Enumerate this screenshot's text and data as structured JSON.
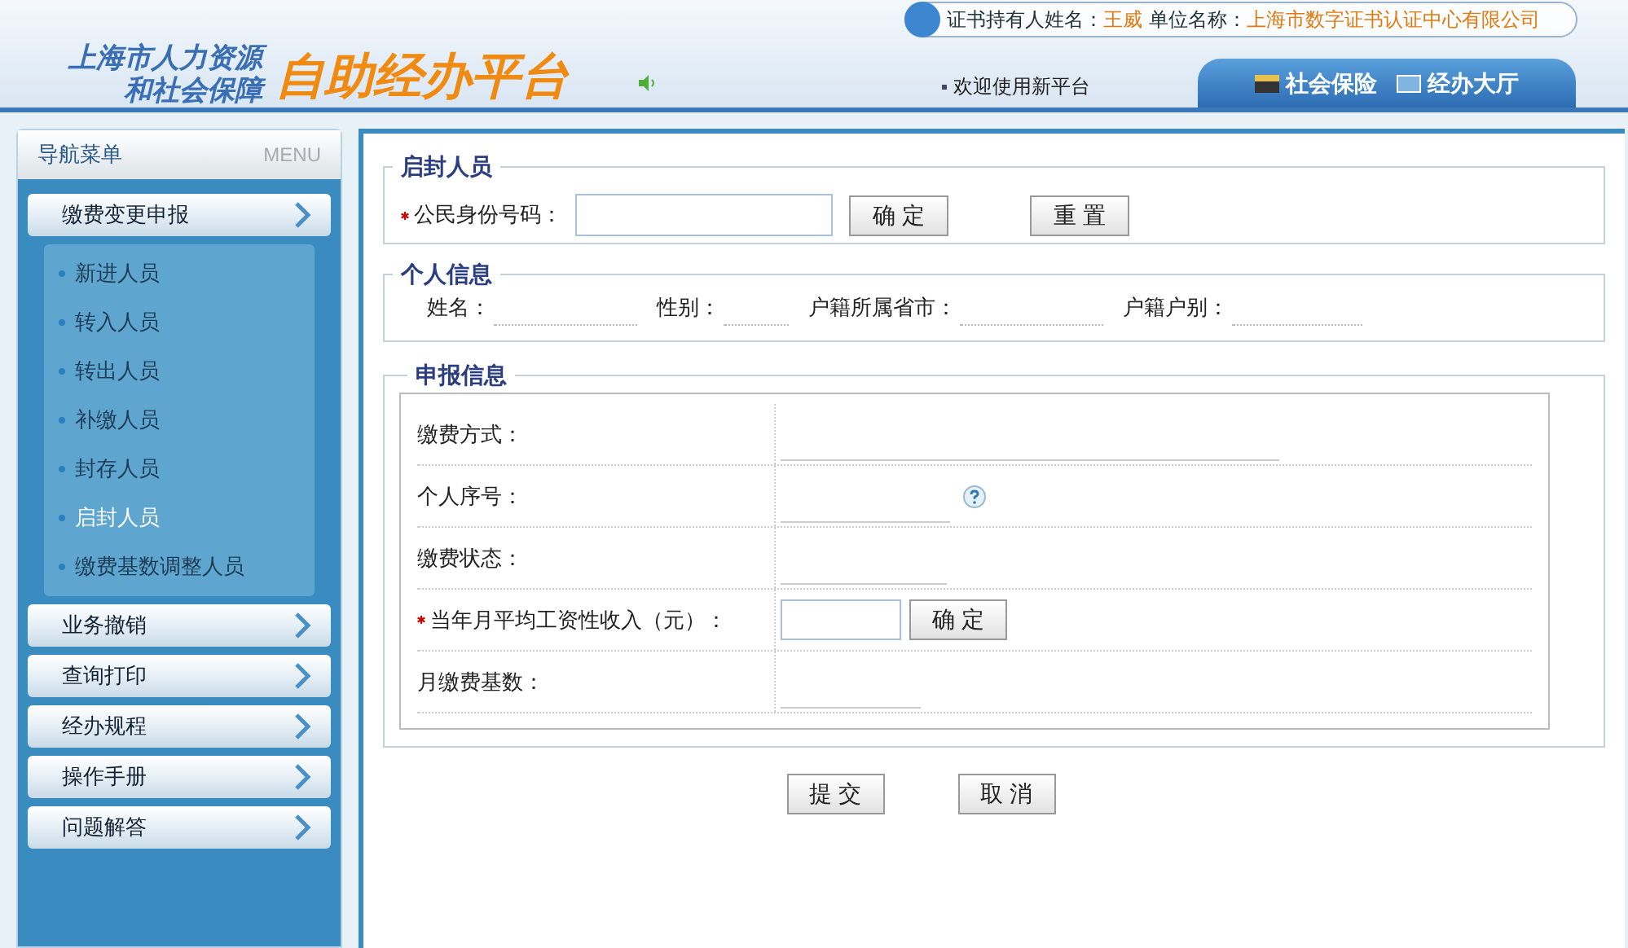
{
  "header": {
    "logo_line1": "上海市人力资源",
    "logo_line2": "和社会保障",
    "logo_main": "自助经办平台",
    "user_label": "证书持有人姓名：",
    "user_name": "王威",
    "unit_label": "单位名称：",
    "unit_name": "上海市数字证书认证中心有限公司",
    "welcome": "欢迎使用新平台",
    "nav": [
      {
        "label": "社会保险"
      },
      {
        "label": "经办大厅"
      }
    ]
  },
  "sidebar": {
    "title": "导航菜单",
    "title_en": "MENU",
    "groups": [
      {
        "label": "缴费变更申报",
        "children": [
          {
            "label": "新进人员",
            "selected": false
          },
          {
            "label": "转入人员",
            "selected": false
          },
          {
            "label": "转出人员",
            "selected": false
          },
          {
            "label": "补缴人员",
            "selected": false
          },
          {
            "label": "封存人员",
            "selected": false
          },
          {
            "label": "启封人员",
            "selected": true
          },
          {
            "label": "缴费基数调整人员",
            "selected": false
          }
        ]
      },
      {
        "label": "业务撤销"
      },
      {
        "label": "查询打印"
      },
      {
        "label": "经办规程"
      },
      {
        "label": "操作手册"
      },
      {
        "label": "问题解答"
      }
    ]
  },
  "search_section": {
    "legend": "启封人员",
    "label": "公民身份号码：",
    "required": true,
    "buttons": [
      "确 定",
      "重 置"
    ]
  },
  "personal_section": {
    "legend": "个人信息",
    "fields": [
      "姓名：",
      "性别：",
      "户籍所属省市：",
      "户籍户别："
    ]
  },
  "report_section": {
    "legend": "申报信息",
    "rows": [
      {
        "kind": "text",
        "label": "缴费方式：",
        "required": false
      },
      {
        "kind": "help",
        "label": "个人序号：",
        "required": false
      },
      {
        "kind": "text",
        "label": "缴费状态：",
        "required": false
      },
      {
        "kind": "input",
        "label": "当年月平均工资性收入（元）：",
        "required": true,
        "button": "确 定"
      },
      {
        "kind": "text",
        "label": "月缴费基数：",
        "required": false
      }
    ]
  },
  "actions": [
    "提 交",
    "取 消"
  ]
}
